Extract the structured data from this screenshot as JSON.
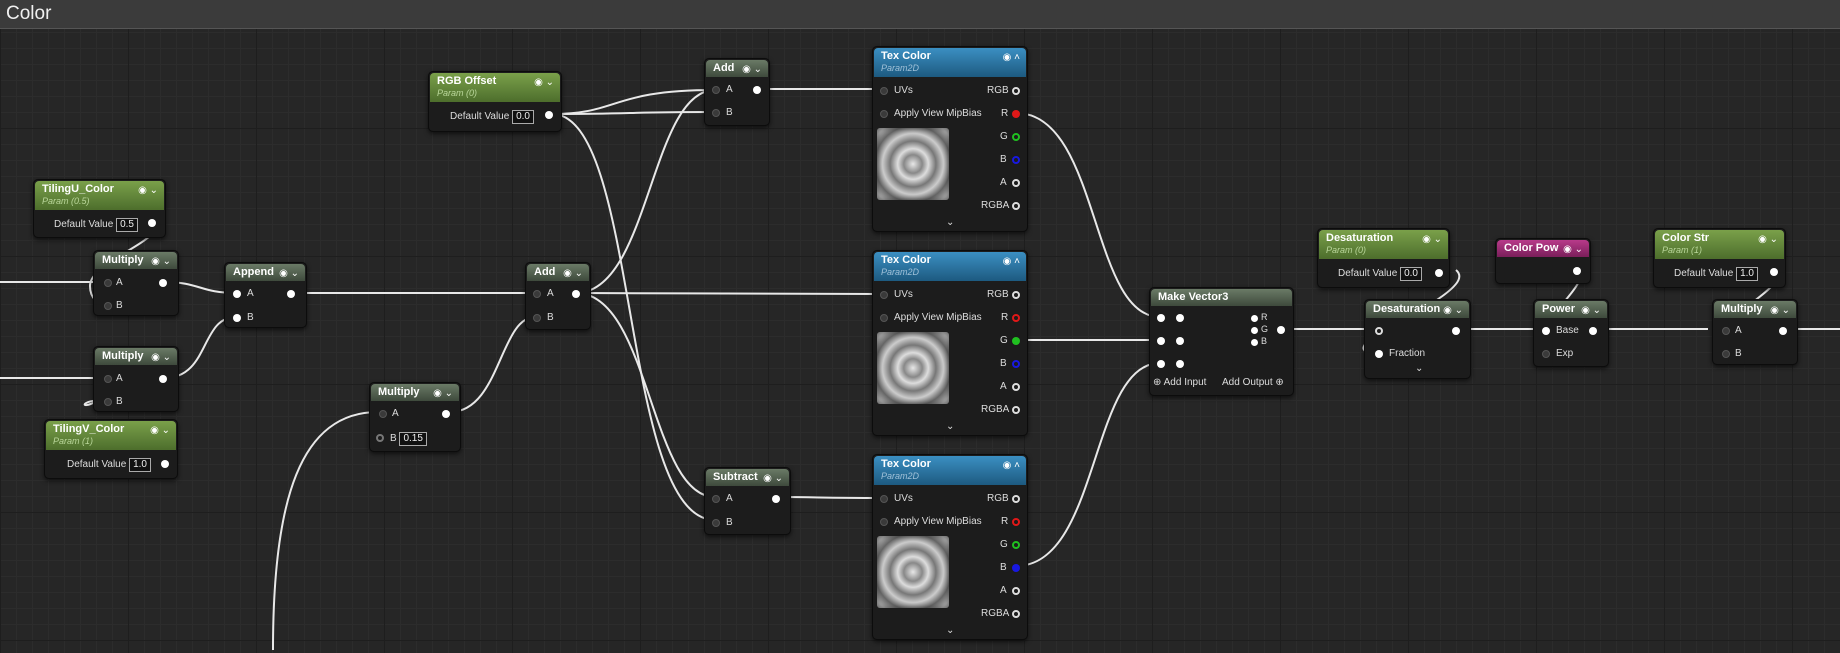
{
  "window": {
    "title": "Color"
  },
  "nodes": {
    "tilingu": {
      "title": "TilingU_Color",
      "subtitle": "Param (0.5)",
      "label": "Default Value",
      "value": "0.5"
    },
    "tilingv": {
      "title": "TilingV_Color",
      "subtitle": "Param (1)",
      "label": "Default Value",
      "value": "1.0"
    },
    "multiply1": {
      "title": "Multiply",
      "a": "A",
      "b": "B"
    },
    "multiply2": {
      "title": "Multiply",
      "a": "A",
      "b": "B"
    },
    "append": {
      "title": "Append",
      "a": "A",
      "b": "B"
    },
    "rgboffset": {
      "title": "RGB Offset",
      "subtitle": "Param (0)",
      "label": "Default Value",
      "value": "0.0"
    },
    "multiply3": {
      "title": "Multiply",
      "a": "A",
      "b": "B",
      "b_value": "0.15"
    },
    "add1": {
      "title": "Add",
      "a": "A",
      "b": "B"
    },
    "add2": {
      "title": "Add",
      "a": "A",
      "b": "B"
    },
    "subtract": {
      "title": "Subtract",
      "a": "A",
      "b": "B"
    },
    "tex1": {
      "title": "Tex Color",
      "subtitle": "Param2D",
      "uvs": "UVs",
      "mip": "Apply View MipBias",
      "rgb": "RGB",
      "r": "R",
      "g": "G",
      "bch": "B",
      "a": "A",
      "rgba": "RGBA"
    },
    "tex2": {
      "title": "Tex Color",
      "subtitle": "Param2D",
      "uvs": "UVs",
      "mip": "Apply View MipBias",
      "rgb": "RGB",
      "r": "R",
      "g": "G",
      "bch": "B",
      "a": "A",
      "rgba": "RGBA"
    },
    "tex3": {
      "title": "Tex Color",
      "subtitle": "Param2D",
      "uvs": "UVs",
      "mip": "Apply View MipBias",
      "rgb": "RGB",
      "r": "R",
      "g": "G",
      "bch": "B",
      "a": "A",
      "rgba": "RGBA"
    },
    "makevec": {
      "title": "Make Vector3",
      "r": "R",
      "g": "G",
      "b": "B",
      "add_input": "Add Input",
      "add_output": "Add Output"
    },
    "desatparam": {
      "title": "Desaturation",
      "subtitle": "Param (0)",
      "label": "Default Value",
      "value": "0.0"
    },
    "desat": {
      "title": "Desaturation",
      "fraction": "Fraction"
    },
    "colorpow": {
      "title": "Color Pow"
    },
    "power": {
      "title": "Power",
      "base": "Base",
      "exp": "Exp"
    },
    "colorstr": {
      "title": "Color Str",
      "subtitle": "Param (1)",
      "label": "Default Value",
      "value": "1.0"
    },
    "multiply4": {
      "title": "Multiply",
      "a": "A",
      "b": "B"
    }
  },
  "colors": {
    "r_pin": "#e01818",
    "g_pin": "#20c020",
    "b_pin": "#1818e0",
    "param_header": "#5c8a32",
    "texture_header": "#2a76a6",
    "vector_header": "#b02a80"
  },
  "icons": [
    "preview-circle-icon",
    "chevron-down-icon",
    "chevron-up-icon",
    "plus-circle-icon"
  ]
}
